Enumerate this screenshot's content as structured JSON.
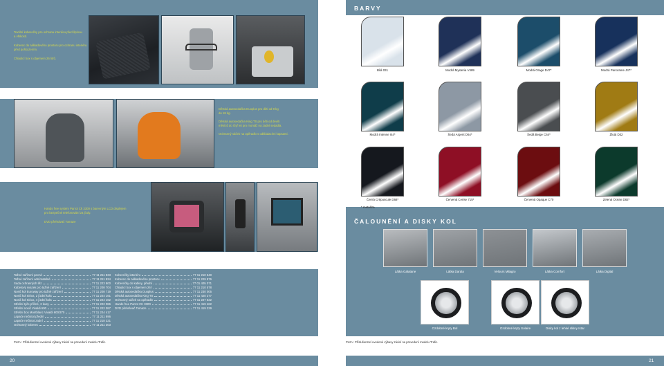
{
  "left": {
    "panel1": {
      "lines": [
        "Textilní koberečky pro ochranu interiéru před špínou",
        "a vlhkostí.",
        "Koberec do nákladového prostoru pro ochranu interiéru",
        "před poškozením.",
        "Chladicí box s objemem 26 litrů."
      ]
    },
    "panel2": {
      "lines": [
        "Dětská autosedačka Duoplus pro děti od 9 kg",
        "do 18 kg.",
        "Dětská autosedačka King TS pro děti od devíti",
        "měsíců do čtyř let pro montáž na zadní sedadla.",
        "Ochranný sáček na opěradlo s odkládacími kapsami."
      ]
    },
    "panel3": {
      "lines": [
        "Hands free systém Parrot Ck 3300 s barevným LCD displejem",
        "pro bezpečné telefonování za jízdy.",
        "DVD přehrávač Tomaze"
      ]
    },
    "accessories_col1": [
      [
        "Tažné zařízení pevné",
        "77 11 211 833"
      ],
      [
        "Tažné zařízení odnímatelné",
        "77 11 211 834"
      ],
      [
        "Sada ochranných lišt",
        "77 11 223 800"
      ],
      [
        "Kabelový svazek pro tažné zařízení",
        "77 11 208 704"
      ],
      [
        "Nosič kol Euroway pro tažné zařízení",
        "77 11 208 719"
      ],
      [
        "Nosič kol Sirius, 2 jízdní kola",
        "77 11 224 161"
      ],
      [
        "Nosič kol Sirius, 4 jízdní kola",
        "77 11 224 162"
      ],
      [
        "Střešní tyče příčné, 2 kusy",
        "77 11 222 086"
      ],
      [
        "Střešní nosič Vivaldi 600",
        "77 11 222 087"
      ],
      [
        "Střešní box Montblanc Vivaldi 600/370",
        "77 11 224 417"
      ],
      [
        "Lapače nečistot přední",
        "77 11 211 896"
      ],
      [
        "Lapače nečistot zadní",
        "77 11 218 321"
      ],
      [
        "Ochranný koberec",
        "77 11 211 303"
      ]
    ],
    "accessories_col2": [
      [
        "Koberečky interiéru",
        "77 11 210 540"
      ],
      [
        "Koberec do nákladového prostoru",
        "77 11 229 876"
      ],
      [
        "Koberečky do kabiny, přední",
        "77 01 405 071"
      ],
      [
        "Chladicí box s objemem 26 l",
        "77 11 210 578"
      ],
      [
        "Dětská autosedačka Duoplus",
        "77 11 230 005"
      ],
      [
        "Dětská autosedačka King TS",
        "77 11 420 277"
      ],
      [
        "Ochranný sáček na opěradlo",
        "77 11 227 522"
      ],
      [
        "Hands free Parrot CK 3300",
        "77 11 419 462"
      ],
      [
        "DVD přehrávač Tomaze",
        "77 11 419 229"
      ]
    ],
    "note": "Pozn.: Příslušenství uvedené výbavy závisí na provedení modelu Trafic.",
    "page_number": "20"
  },
  "right": {
    "title": "BARVY",
    "colors_row1": [
      "Bílá 031",
      "Modrá Mysteria V489",
      "Modrá Orage D47*",
      "Modrá Panorame J47*"
    ],
    "colors_row2": [
      "Modrá Intense I44*",
      "Šedá Argent D64*",
      "Šedá Beige C64*",
      "Žlutá D32"
    ],
    "colors_row3": [
      "Černá Crépuscule D68*",
      "Červená Cerise 715*",
      "Červená Opaque C70",
      "Zelená Océan D82*"
    ],
    "metallic_note": "* metalíza",
    "section_title": "ČALOUNĚNÍ A DISKY KOL",
    "upholstery": [
      "Látka Galatane",
      "Látka Darala",
      "Velours Milagro",
      "Látka Comfort",
      "Látka Digital"
    ],
    "wheels": [
      "Ozdobné kryty Bol",
      "Ozdobné kryty Solaire",
      "Disky kol z lehké slitiny Istar"
    ],
    "note": "Pozn.: Příslušenství uvedené výbavy závisí na provedení modelu Trafic.",
    "page_number": "21"
  },
  "colors": {
    "band": "#6a8ca0",
    "accent_yellow": "#d6d94a",
    "swatches_row1": [
      "#d9e2ea",
      "#1f3158",
      "#1c4d6a",
      "#17315c"
    ],
    "swatches_row2": [
      "#0f3d4a",
      "#8d98a4",
      "#4a4d50",
      "#a07b14"
    ],
    "swatches_row3": [
      "#15181e",
      "#8e0f25",
      "#6c0d10",
      "#0c3a2c"
    ]
  }
}
